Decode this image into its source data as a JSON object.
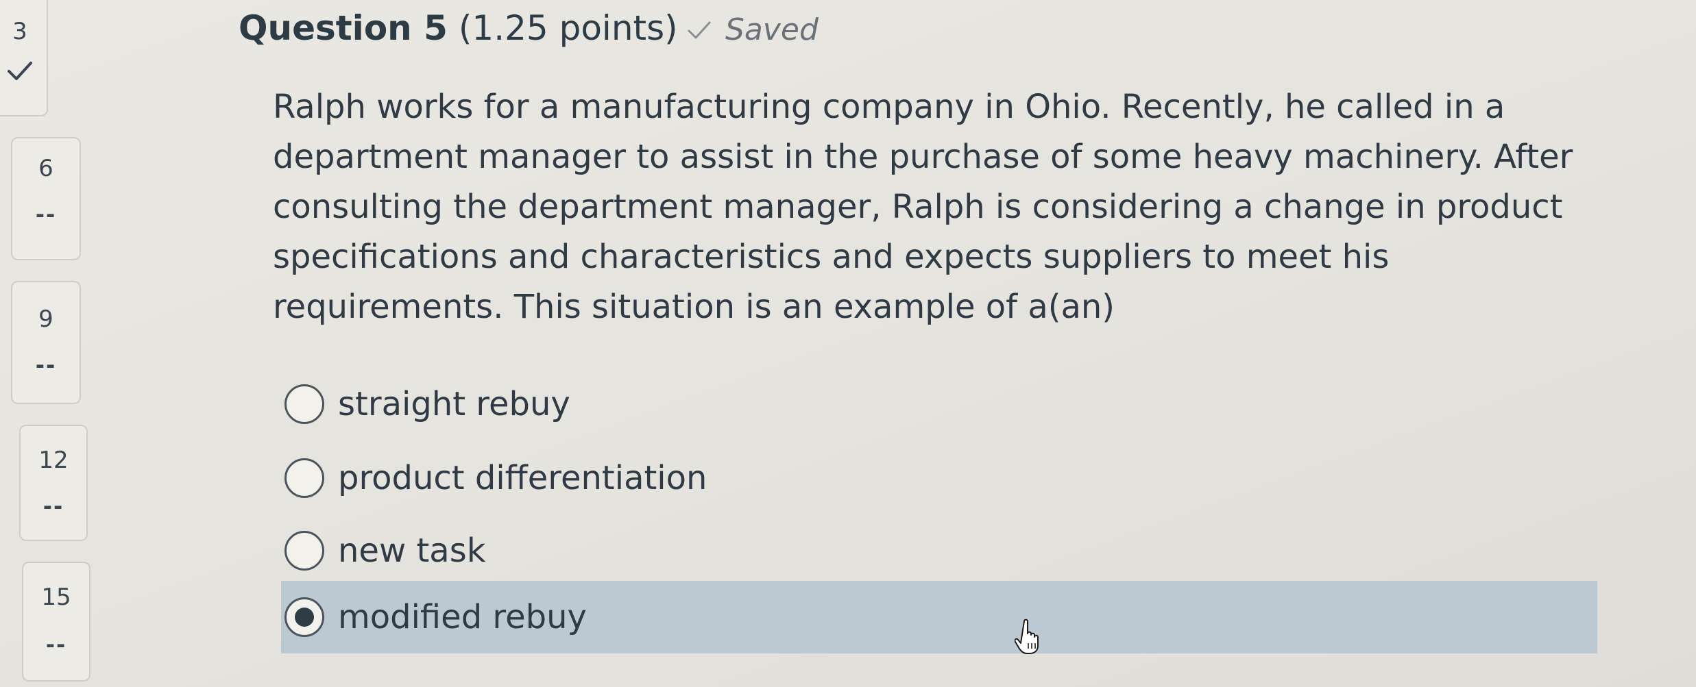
{
  "navigator": {
    "items": [
      {
        "number": "3",
        "status": "",
        "answered": true
      },
      {
        "number": "6",
        "status": "--",
        "answered": false
      },
      {
        "number": "9",
        "status": "--",
        "answered": false
      },
      {
        "number": "12",
        "status": "--",
        "answered": false
      },
      {
        "number": "15",
        "status": "--",
        "answered": false
      }
    ]
  },
  "question": {
    "title": "Question 5",
    "points": "(1.25 points)",
    "saved_label": "Saved",
    "text": "Ralph works for a manufacturing company in Ohio. Recently, he called in a department manager to assist in the purchase of some heavy machinery. After consulting the department manager, Ralph is considering a change in product specifications and characteristics and expects suppliers to meet his requirements. This situation is an example of a(an)",
    "answers": [
      {
        "label": "straight rebuy",
        "selected": false
      },
      {
        "label": "product differentiation",
        "selected": false
      },
      {
        "label": "new task",
        "selected": false
      },
      {
        "label": "modified rebuy",
        "selected": true
      }
    ]
  },
  "colors": {
    "selected_answer_bg": "#bcc9d3",
    "text": "#2d3b45",
    "saved_text": "#6b7178"
  },
  "icons": {
    "answered": "checkmark-icon",
    "saved": "checkmark-icon",
    "radio": "radio-button-icon",
    "pointer": "hand-cursor-icon"
  }
}
